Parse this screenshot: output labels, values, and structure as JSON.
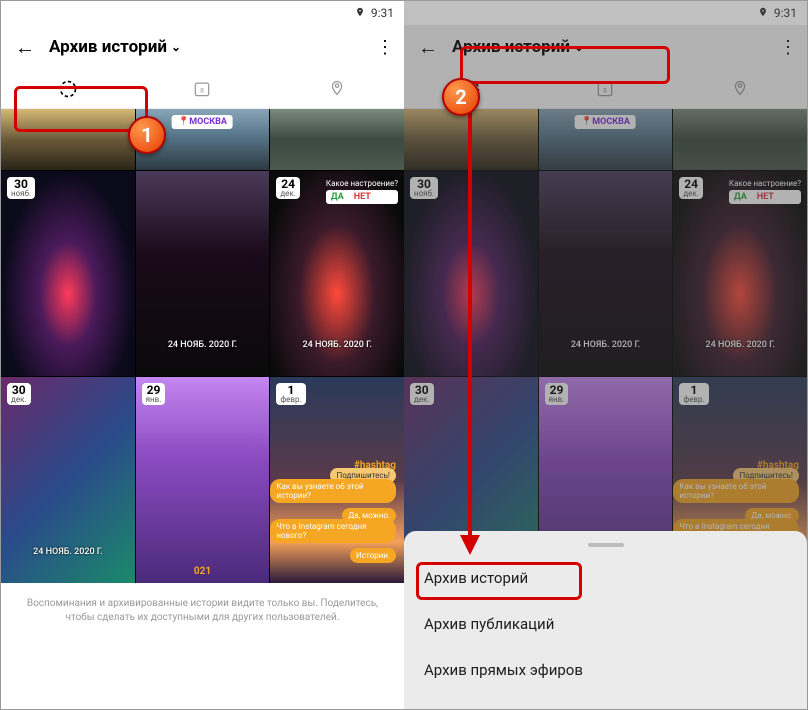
{
  "status": {
    "time": "9:31"
  },
  "header": {
    "title": "Архив историй"
  },
  "grid": [
    {
      "cls": "g1 short",
      "loc": ""
    },
    {
      "cls": "g2 short",
      "loc": "МОСКВА"
    },
    {
      "cls": "g3 short",
      "loc": ""
    },
    {
      "cls": "g4",
      "day": "30",
      "mon": "нояб.",
      "cap": ""
    },
    {
      "cls": "g5",
      "day": "",
      "mon": "",
      "cap": "24 НОЯБ. 2020 Г."
    },
    {
      "cls": "g6",
      "day": "24",
      "mon": "дек.",
      "cap": "24 НОЯБ. 2020 Г.",
      "poll": {
        "q": "Какое настроение?",
        "y": "ДА",
        "n": "НЕТ"
      }
    },
    {
      "cls": "g7",
      "day": "30",
      "mon": "дек.",
      "cap": "24 НОЯБ. 2020 Г."
    },
    {
      "cls": "g8",
      "day": "29",
      "mon": "янв.",
      "yr": "021"
    },
    {
      "cls": "g9",
      "day": "1",
      "mon": "февр.",
      "hash": "#hashtag",
      "stk": {
        "q": "Подпишитесь!",
        "a1": "Как вы узнаете об этой истории?",
        "a2": "Да, можно.",
        "a3": "Что в Instagram сегодня нового?",
        "a4": "Истории."
      }
    }
  ],
  "footer": "Воспоминания и архивированные истории видите только вы. Поделитесь, чтобы сделать их доступными для других пользователей.",
  "sheet": {
    "items": [
      "Архив историй",
      "Архив публикаций",
      "Архив прямых эфиров"
    ]
  },
  "callouts": {
    "one": "1",
    "two": "2"
  }
}
